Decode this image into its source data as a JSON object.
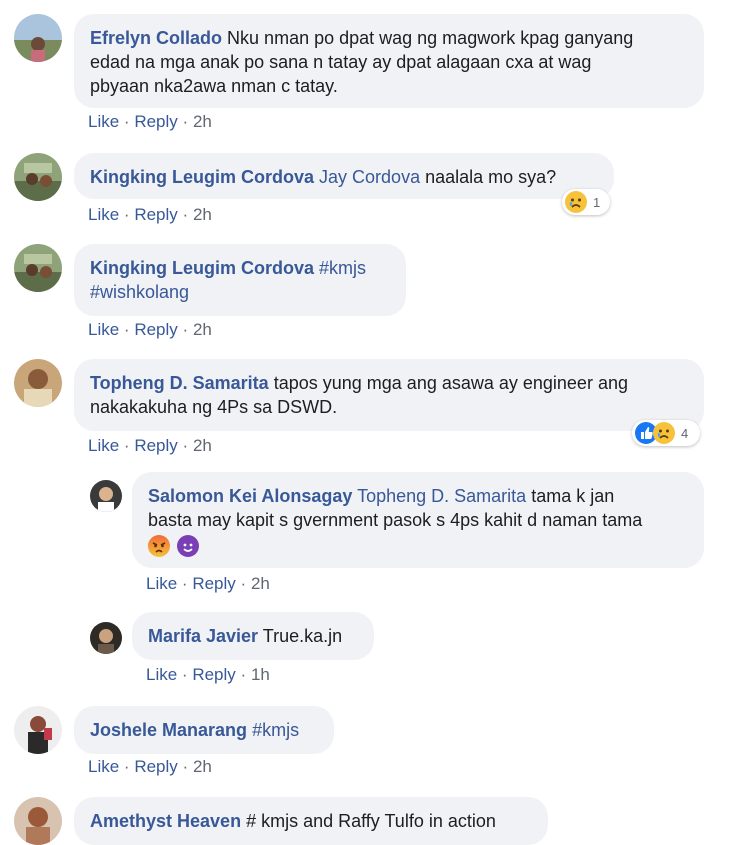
{
  "comments": [
    {
      "author": "Efrelyn Collado",
      "text_lines": [
        "Nku nman po dpat wag ng magwork kpag ganyang",
        "edad na mga anak po sana n tatay ay dpat alagaan cxa at wag",
        "pbyaan nka2awa nman c tatay."
      ],
      "like": "Like",
      "reply": "Reply",
      "time": "2h"
    },
    {
      "author": "Kingking Leugim Cordova",
      "mention": "Jay Cordova",
      "text": "naalala mo sya?",
      "like": "Like",
      "reply": "Reply",
      "time": "2h",
      "reaction_count": "1"
    },
    {
      "author": "Kingking Leugim Cordova",
      "tag1": "#kmjs",
      "tag2": "#wishkolang",
      "like": "Like",
      "reply": "Reply",
      "time": "2h"
    },
    {
      "author": "Topheng D. Samarita",
      "text1": "tapos yung mga ang asawa ay engineer ang",
      "text2": "nakakakuha ng 4Ps sa DSWD.",
      "like": "Like",
      "reply": "Reply",
      "time": "2h",
      "reaction_count": "4"
    },
    {
      "author": "Salomon Kei Alonsagay",
      "mention": "Topheng D. Samarita",
      "text1": "tama k jan",
      "text2": "basta may kapit s gvernment pasok s 4ps kahit d naman tama",
      "like": "Like",
      "reply": "Reply",
      "time": "2h"
    },
    {
      "author": "Marifa Javier",
      "text": "True.ka.jn",
      "like": "Like",
      "reply": "Reply",
      "time": "1h"
    },
    {
      "author": "Joshele Manarang",
      "tag": "#kmjs",
      "like": "Like",
      "reply": "Reply",
      "time": "2h"
    },
    {
      "author": "Amethyst Heaven",
      "text": "# kmjs and Raffy Tulfo in action"
    }
  ],
  "separator": "·",
  "colors": {
    "link": "#385898",
    "bubble": "#f0f2f5",
    "meta": "#606770",
    "like_blue": "#1877f2",
    "sad_yellow": "#f7c23b"
  },
  "icons": {
    "sad_reaction": "sad-reaction-icon",
    "like_reaction": "like-reaction-icon",
    "angry_emoji": "angry-emoji-icon",
    "devil_emoji": "devil-emoji-icon"
  }
}
